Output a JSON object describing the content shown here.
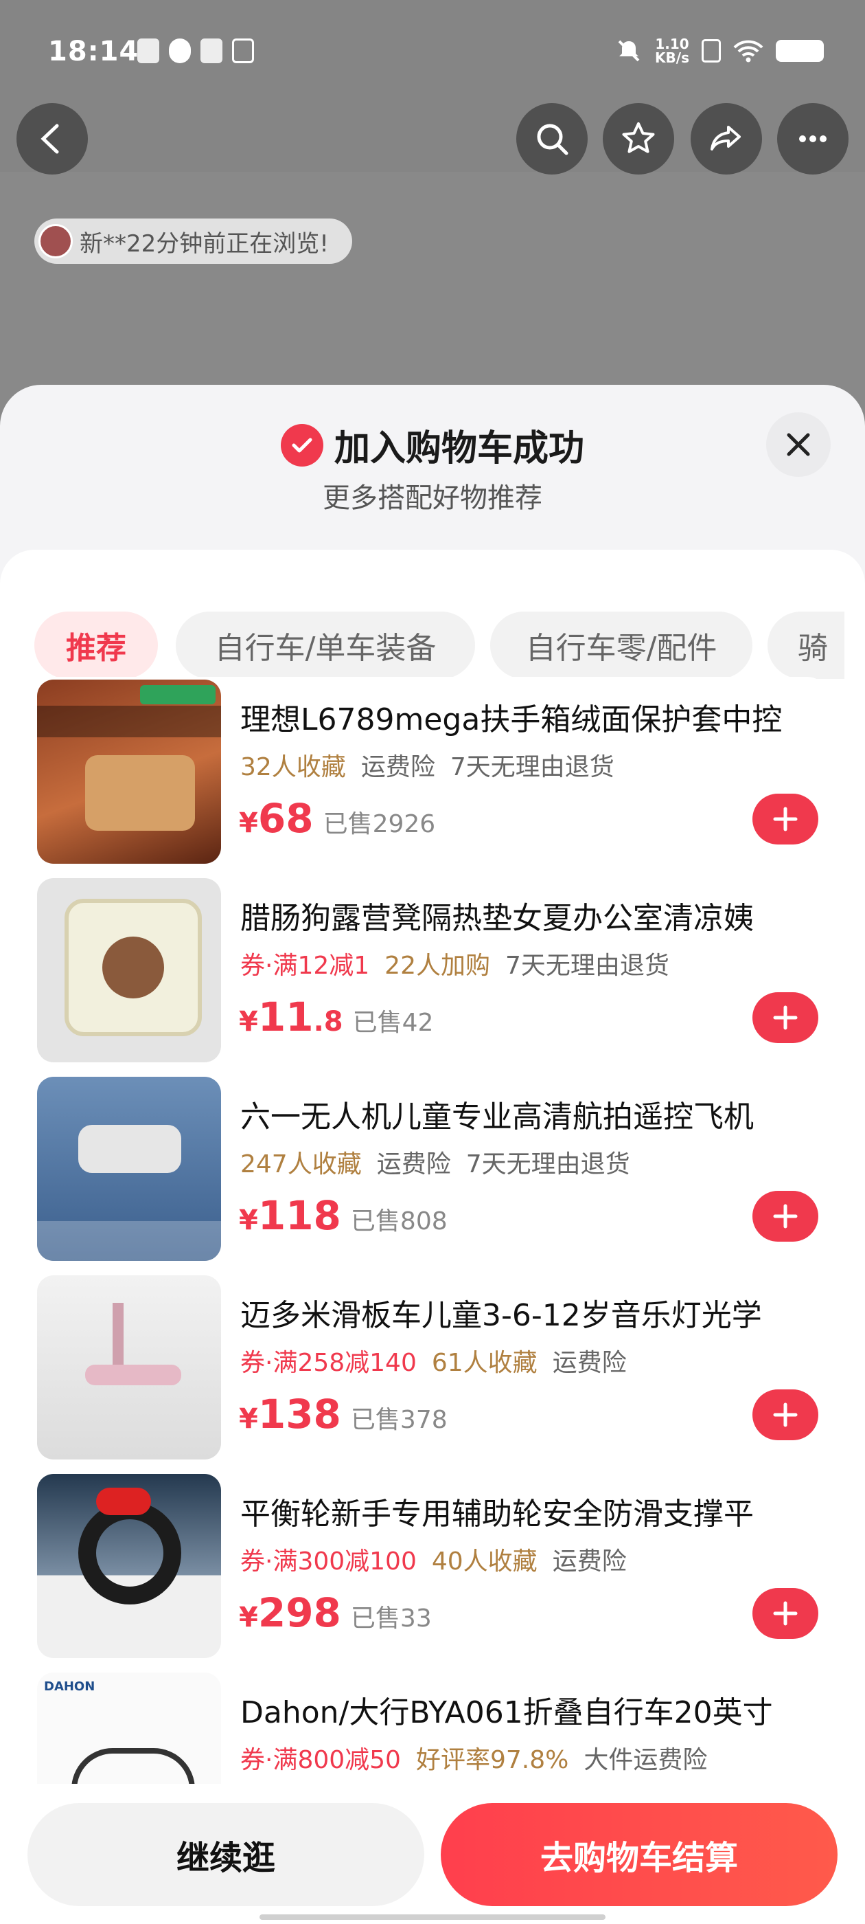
{
  "status_bar": {
    "time": "18:14",
    "net_speed_value": "1.10",
    "net_speed_unit": "KB/s",
    "icons": [
      "task-icon",
      "map-icon",
      "mail-icon",
      "usb-icon",
      "mute-icon",
      "sim-icon",
      "wifi-icon",
      "battery-icon"
    ]
  },
  "top_nav": {
    "back_icon": "back-icon",
    "search_icon": "search-icon",
    "favorite_icon": "star-icon",
    "share_icon": "share-icon",
    "more_icon": "more-icon"
  },
  "viewer_notice": "新**22分钟前正在浏览!",
  "cart_sheet": {
    "title": "加入购物车成功",
    "subtitle": "更多搭配好物推荐",
    "tabs": [
      {
        "label": "推荐",
        "active": true
      },
      {
        "label": "自行车/单车装备",
        "active": false
      },
      {
        "label": "自行车零/配件",
        "active": false
      },
      {
        "label": "骑",
        "active": false
      }
    ],
    "products": [
      {
        "name": "理想L6789mega扶手箱绒面保护套中控",
        "tags": [
          {
            "text": "32人收藏",
            "kind": "fav"
          },
          {
            "text": "运费险",
            "kind": "plain"
          },
          {
            "text": "7天无理由退货",
            "kind": "plain"
          }
        ],
        "price_symbol": "¥",
        "price_int": "68",
        "price_dec": "",
        "sold": "已售2926"
      },
      {
        "name": "腊肠狗露营凳隔热垫女夏办公室清凉姨",
        "tags": [
          {
            "text": "券·满12减1",
            "kind": "coupon"
          },
          {
            "text": "22人加购",
            "kind": "fav"
          },
          {
            "text": "7天无理由退货",
            "kind": "plain"
          }
        ],
        "price_symbol": "¥",
        "price_int": "11",
        "price_dec": ".8",
        "sold": "已售42"
      },
      {
        "name": "六一无人机儿童专业高清航拍遥控飞机",
        "tags": [
          {
            "text": "247人收藏",
            "kind": "fav"
          },
          {
            "text": "运费险",
            "kind": "plain"
          },
          {
            "text": "7天无理由退货",
            "kind": "plain"
          }
        ],
        "price_symbol": "¥",
        "price_int": "118",
        "price_dec": "",
        "sold": "已售808"
      },
      {
        "name": "迈多米滑板车儿童3-6-12岁音乐灯光学",
        "tags": [
          {
            "text": "券·满258减140",
            "kind": "coupon"
          },
          {
            "text": "61人收藏",
            "kind": "fav"
          },
          {
            "text": "运费险",
            "kind": "plain"
          }
        ],
        "price_symbol": "¥",
        "price_int": "138",
        "price_dec": "",
        "sold": "已售378"
      },
      {
        "name": "平衡轮新手专用辅助轮安全防滑支撑平",
        "tags": [
          {
            "text": "券·满300减100",
            "kind": "coupon"
          },
          {
            "text": "40人收藏",
            "kind": "fav"
          },
          {
            "text": "运费险",
            "kind": "plain"
          }
        ],
        "price_symbol": "¥",
        "price_int": "298",
        "price_dec": "",
        "sold": "已售33"
      },
      {
        "name": "Dahon/大行BYA061折叠自行车20英寸",
        "tags": [
          {
            "text": "券·满800减50",
            "kind": "coupon"
          },
          {
            "text": "好评率97.8%",
            "kind": "fav"
          },
          {
            "text": "大件运费险",
            "kind": "plain"
          }
        ],
        "price_symbol": "",
        "price_int": "",
        "price_dec": "",
        "sold": ""
      }
    ]
  },
  "bottom_bar": {
    "continue_label": "继续逛",
    "checkout_label": "去购物车结算"
  },
  "colors": {
    "accent": "#f0394d",
    "fav_tag": "#b08040",
    "plain_tag": "#666666"
  }
}
